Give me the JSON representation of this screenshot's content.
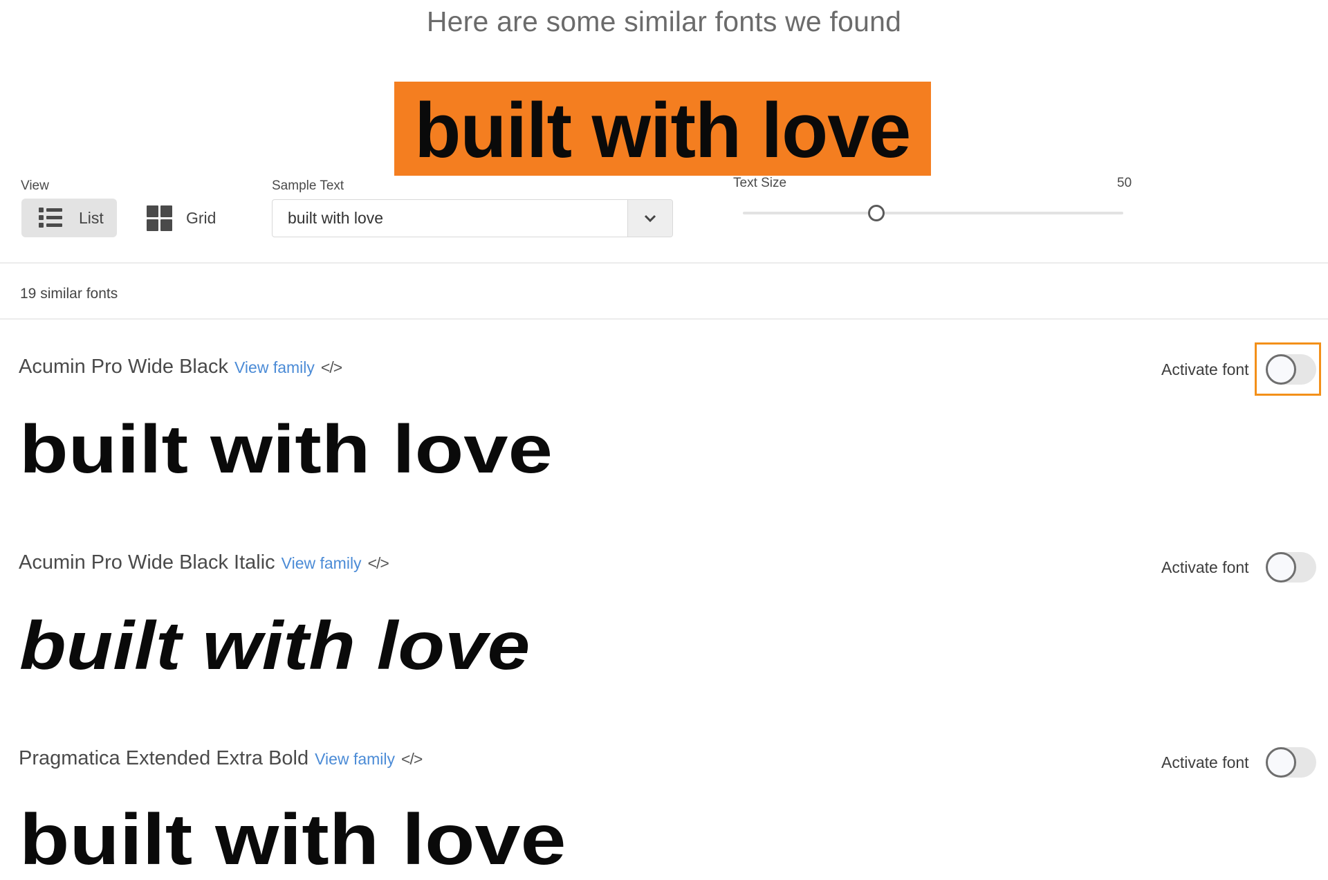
{
  "header": {
    "title": "Here are some similar fonts we found",
    "hero_text": "built with love",
    "hero_color": "#F47E20"
  },
  "controls": {
    "view": {
      "label": "View",
      "options": [
        {
          "label": "List",
          "icon": "list-icon",
          "selected": true
        },
        {
          "label": "Grid",
          "icon": "grid-icon",
          "selected": false
        }
      ]
    },
    "sample_text": {
      "label": "Sample Text",
      "value": "built with love",
      "dropdown_icon": "chevron-down-icon"
    },
    "text_size": {
      "label": "Text Size",
      "value": "50",
      "slider_fraction": 0.35
    }
  },
  "results": {
    "count_label": "19 similar fonts",
    "fonts": [
      {
        "name": "Acumin Pro Wide Black",
        "view_family": "View family",
        "code_icon": "</>",
        "activate_label": "Activate font",
        "active": false,
        "focused": true,
        "specimen": "built with love"
      },
      {
        "name": "Acumin Pro Wide Black Italic",
        "view_family": "View family",
        "code_icon": "</>",
        "activate_label": "Activate font",
        "active": false,
        "focused": false,
        "specimen": "built with love"
      },
      {
        "name": "Pragmatica Extended Extra Bold",
        "view_family": "View family",
        "code_icon": "</>",
        "activate_label": "Activate font",
        "active": false,
        "focused": false,
        "specimen": "built with love"
      }
    ]
  },
  "colors": {
    "accent_orange": "#F47E20",
    "focus_ring": "#F39019",
    "link_blue": "#4B8BD6"
  }
}
